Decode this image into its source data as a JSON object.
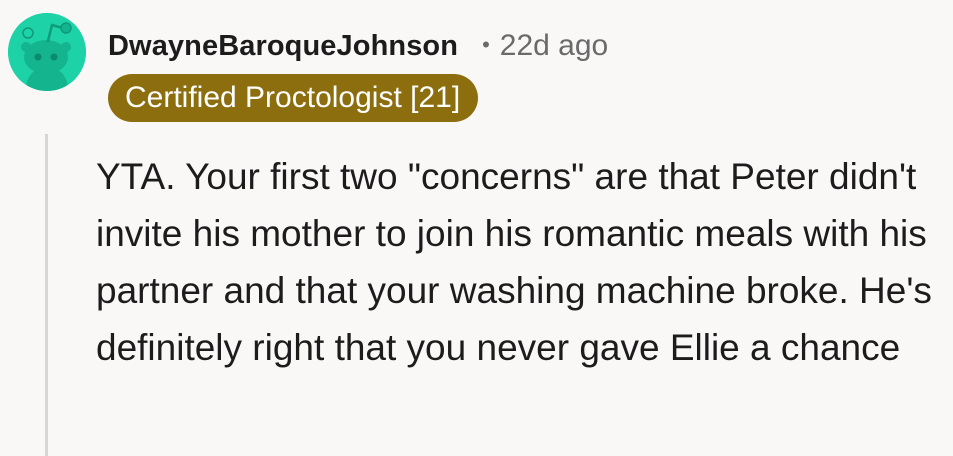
{
  "comment": {
    "author": "DwayneBaroqueJohnson",
    "separator": "•",
    "timestamp": "22d ago",
    "flair": "Certified Proctologist [21]",
    "avatar_icon": "snoo-avatar-icon",
    "body": "YTA. Your first two \"concerns\" are that Peter didn't invite his mother to join his romantic meals with his partner and that your washing machine broke. He's definitely right that you never gave Ellie a chance"
  },
  "colors": {
    "background": "#f9f8f7",
    "avatar_bg": "#1ed2a8",
    "flair_bg": "#8d6e0f",
    "flair_text": "#ffffff",
    "meta_text": "#6a6a6a",
    "thread_line": "#d8d6d3"
  }
}
